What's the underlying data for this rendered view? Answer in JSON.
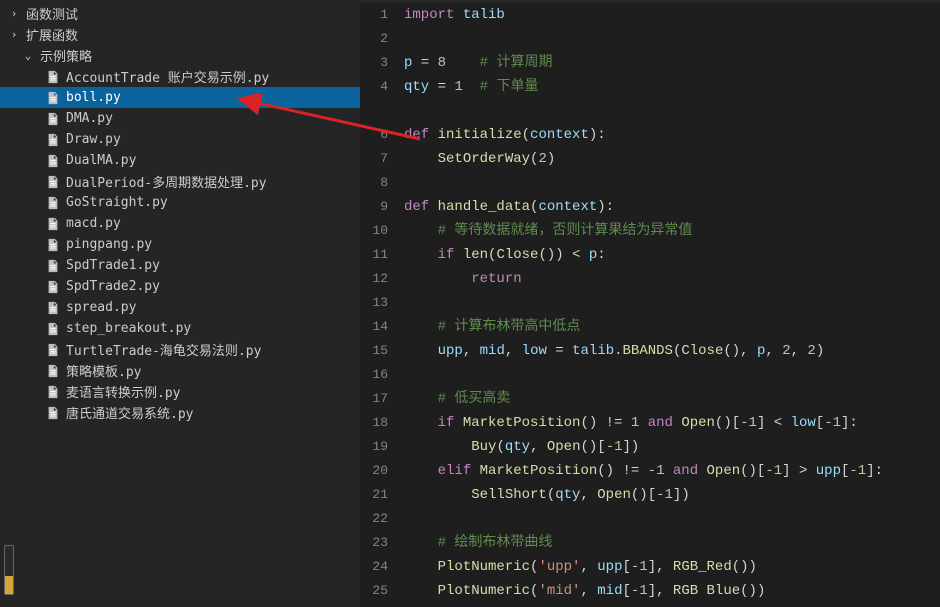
{
  "sidebar": {
    "folders": [
      {
        "label": "函数测试",
        "expanded": false
      },
      {
        "label": "扩展函数",
        "expanded": false
      },
      {
        "label": "示例策略",
        "expanded": true
      }
    ],
    "files": [
      {
        "label": "AccountTrade 账户交易示例.py",
        "selected": false
      },
      {
        "label": "boll.py",
        "selected": true
      },
      {
        "label": "DMA.py",
        "selected": false
      },
      {
        "label": "Draw.py",
        "selected": false
      },
      {
        "label": "DualMA.py",
        "selected": false
      },
      {
        "label": "DualPeriod-多周期数据处理.py",
        "selected": false
      },
      {
        "label": "GoStraight.py",
        "selected": false
      },
      {
        "label": "macd.py",
        "selected": false
      },
      {
        "label": "pingpang.py",
        "selected": false
      },
      {
        "label": "SpdTrade1.py",
        "selected": false
      },
      {
        "label": "SpdTrade2.py",
        "selected": false
      },
      {
        "label": "spread.py",
        "selected": false
      },
      {
        "label": "step_breakout.py",
        "selected": false
      },
      {
        "label": "TurtleTrade-海龟交易法则.py",
        "selected": false
      },
      {
        "label": "策略模板.py",
        "selected": false
      },
      {
        "label": "麦语言转换示例.py",
        "selected": false
      },
      {
        "label": "唐氏通道交易系统.py",
        "selected": false
      }
    ]
  },
  "code": {
    "lines": [
      {
        "no": "1",
        "tokens": [
          [
            "kw",
            "import"
          ],
          [
            "op",
            " "
          ],
          [
            "ident",
            "talib"
          ]
        ]
      },
      {
        "no": "2",
        "tokens": []
      },
      {
        "no": "3",
        "tokens": [
          [
            "ident",
            "p"
          ],
          [
            "op",
            " = "
          ],
          [
            "num",
            "8"
          ],
          [
            "op",
            "    "
          ],
          [
            "cmt",
            "# 计算周期"
          ]
        ]
      },
      {
        "no": "4",
        "tokens": [
          [
            "ident",
            "qty"
          ],
          [
            "op",
            " = "
          ],
          [
            "num",
            "1"
          ],
          [
            "op",
            "  "
          ],
          [
            "cmt",
            "# 下单量"
          ]
        ]
      },
      {
        "no": "",
        "tokens": []
      },
      {
        "no": "6",
        "tokens": [
          [
            "kw",
            "def"
          ],
          [
            "op",
            " "
          ],
          [
            "fn",
            "initialize"
          ],
          [
            "op",
            "("
          ],
          [
            "ident",
            "context"
          ],
          [
            "op",
            "):"
          ]
        ]
      },
      {
        "no": "7",
        "tokens": [
          [
            "op",
            "    "
          ],
          [
            "fn",
            "SetOrderWay"
          ],
          [
            "op",
            "("
          ],
          [
            "num",
            "2"
          ],
          [
            "op",
            ")"
          ]
        ]
      },
      {
        "no": "8",
        "tokens": []
      },
      {
        "no": "9",
        "tokens": [
          [
            "kw",
            "def"
          ],
          [
            "op",
            " "
          ],
          [
            "fn",
            "handle_data"
          ],
          [
            "op",
            "("
          ],
          [
            "ident",
            "context"
          ],
          [
            "op",
            "):"
          ]
        ]
      },
      {
        "no": "10",
        "tokens": [
          [
            "op",
            "    "
          ],
          [
            "cmt",
            "# 等待数据就绪，否则计算果结为异常值"
          ]
        ]
      },
      {
        "no": "11",
        "tokens": [
          [
            "op",
            "    "
          ],
          [
            "kw",
            "if"
          ],
          [
            "op",
            " "
          ],
          [
            "fn",
            "len"
          ],
          [
            "op",
            "("
          ],
          [
            "fn",
            "Close"
          ],
          [
            "op",
            "()) < "
          ],
          [
            "ident",
            "p"
          ],
          [
            "op",
            ":"
          ]
        ]
      },
      {
        "no": "12",
        "tokens": [
          [
            "op",
            "        "
          ],
          [
            "kw",
            "return"
          ]
        ]
      },
      {
        "no": "13",
        "tokens": []
      },
      {
        "no": "14",
        "tokens": [
          [
            "op",
            "    "
          ],
          [
            "cmt",
            "# 计算布林带高中低点"
          ]
        ]
      },
      {
        "no": "15",
        "tokens": [
          [
            "op",
            "    "
          ],
          [
            "ident",
            "upp"
          ],
          [
            "op",
            ", "
          ],
          [
            "ident",
            "mid"
          ],
          [
            "op",
            ", "
          ],
          [
            "ident",
            "low"
          ],
          [
            "op",
            " = "
          ],
          [
            "ident",
            "talib"
          ],
          [
            "op",
            "."
          ],
          [
            "fn",
            "BBANDS"
          ],
          [
            "op",
            "("
          ],
          [
            "fn",
            "Close"
          ],
          [
            "op",
            "(), "
          ],
          [
            "ident",
            "p"
          ],
          [
            "op",
            ", "
          ],
          [
            "num",
            "2"
          ],
          [
            "op",
            ", "
          ],
          [
            "num",
            "2"
          ],
          [
            "op",
            ")"
          ]
        ]
      },
      {
        "no": "16",
        "tokens": []
      },
      {
        "no": "17",
        "tokens": [
          [
            "op",
            "    "
          ],
          [
            "cmt",
            "# 低买高卖"
          ]
        ]
      },
      {
        "no": "18",
        "tokens": [
          [
            "op",
            "    "
          ],
          [
            "kw",
            "if"
          ],
          [
            "op",
            " "
          ],
          [
            "fn",
            "MarketPosition"
          ],
          [
            "op",
            "() != "
          ],
          [
            "num",
            "1"
          ],
          [
            "op",
            " "
          ],
          [
            "kw",
            "and"
          ],
          [
            "op",
            " "
          ],
          [
            "fn",
            "Open"
          ],
          [
            "op",
            "()["
          ],
          [
            "num",
            "-1"
          ],
          [
            "op",
            "] < "
          ],
          [
            "ident",
            "low"
          ],
          [
            "op",
            "["
          ],
          [
            "num",
            "-1"
          ],
          [
            "op",
            "]:"
          ]
        ]
      },
      {
        "no": "19",
        "tokens": [
          [
            "op",
            "        "
          ],
          [
            "fn",
            "Buy"
          ],
          [
            "op",
            "("
          ],
          [
            "ident",
            "qty"
          ],
          [
            "op",
            ", "
          ],
          [
            "fn",
            "Open"
          ],
          [
            "op",
            "()["
          ],
          [
            "num",
            "-1"
          ],
          [
            "op",
            "])"
          ]
        ]
      },
      {
        "no": "20",
        "tokens": [
          [
            "op",
            "    "
          ],
          [
            "kw",
            "elif"
          ],
          [
            "op",
            " "
          ],
          [
            "fn",
            "MarketPosition"
          ],
          [
            "op",
            "() != "
          ],
          [
            "num",
            "-1"
          ],
          [
            "op",
            " "
          ],
          [
            "kw",
            "and"
          ],
          [
            "op",
            " "
          ],
          [
            "fn",
            "Open"
          ],
          [
            "op",
            "()["
          ],
          [
            "num",
            "-1"
          ],
          [
            "op",
            "] > "
          ],
          [
            "ident",
            "upp"
          ],
          [
            "op",
            "["
          ],
          [
            "num",
            "-1"
          ],
          [
            "op",
            "]:"
          ]
        ]
      },
      {
        "no": "21",
        "tokens": [
          [
            "op",
            "        "
          ],
          [
            "fn",
            "SellShort"
          ],
          [
            "op",
            "("
          ],
          [
            "ident",
            "qty"
          ],
          [
            "op",
            ", "
          ],
          [
            "fn",
            "Open"
          ],
          [
            "op",
            "()["
          ],
          [
            "num",
            "-1"
          ],
          [
            "op",
            "])"
          ]
        ]
      },
      {
        "no": "22",
        "tokens": []
      },
      {
        "no": "23",
        "tokens": [
          [
            "op",
            "    "
          ],
          [
            "cmt",
            "# 绘制布林带曲线"
          ]
        ]
      },
      {
        "no": "24",
        "tokens": [
          [
            "op",
            "    "
          ],
          [
            "fn",
            "PlotNumeric"
          ],
          [
            "op",
            "("
          ],
          [
            "str",
            "'upp'"
          ],
          [
            "op",
            ", "
          ],
          [
            "ident",
            "upp"
          ],
          [
            "op",
            "["
          ],
          [
            "num",
            "-1"
          ],
          [
            "op",
            "], "
          ],
          [
            "fn",
            "RGB_Red"
          ],
          [
            "op",
            "())"
          ]
        ]
      },
      {
        "no": "25",
        "tokens": [
          [
            "op",
            "    "
          ],
          [
            "fn",
            "PlotNumeric"
          ],
          [
            "op",
            "("
          ],
          [
            "str",
            "'mid'"
          ],
          [
            "op",
            ", "
          ],
          [
            "ident",
            "mid"
          ],
          [
            "op",
            "["
          ],
          [
            "num",
            "-1"
          ],
          [
            "op",
            "], "
          ],
          [
            "fn",
            "RGB Blue"
          ],
          [
            "op",
            "())"
          ]
        ]
      }
    ]
  }
}
